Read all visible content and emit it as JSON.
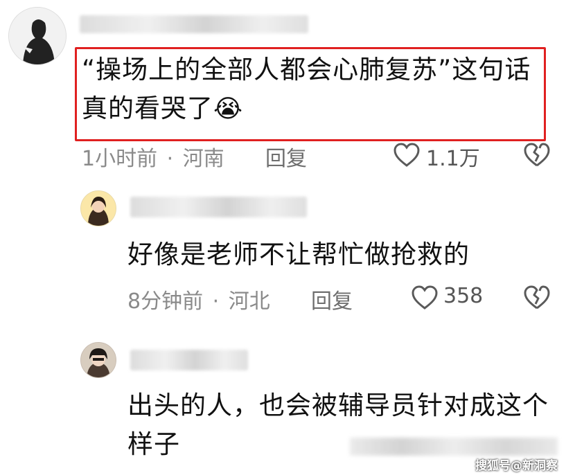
{
  "comments": [
    {
      "text": "“操场上的全部人都会心肺复苏”这句话真的看哭了",
      "emoji": "😭",
      "time": "1小时前",
      "location": "河南",
      "reply_label": "回复",
      "likes": "1.1万"
    },
    {
      "text": "好像是老师不让帮忙做抢救的",
      "time": "8分钟前",
      "location": "河北",
      "reply_label": "回复",
      "likes": "358"
    },
    {
      "text": "出头的人，也会被辅导员针对成这个样子"
    }
  ],
  "meta_separator": "·",
  "watermark": "搜狐号@新洞察",
  "colors": {
    "highlight": "#e02020",
    "meta": "#8a8a8a"
  }
}
